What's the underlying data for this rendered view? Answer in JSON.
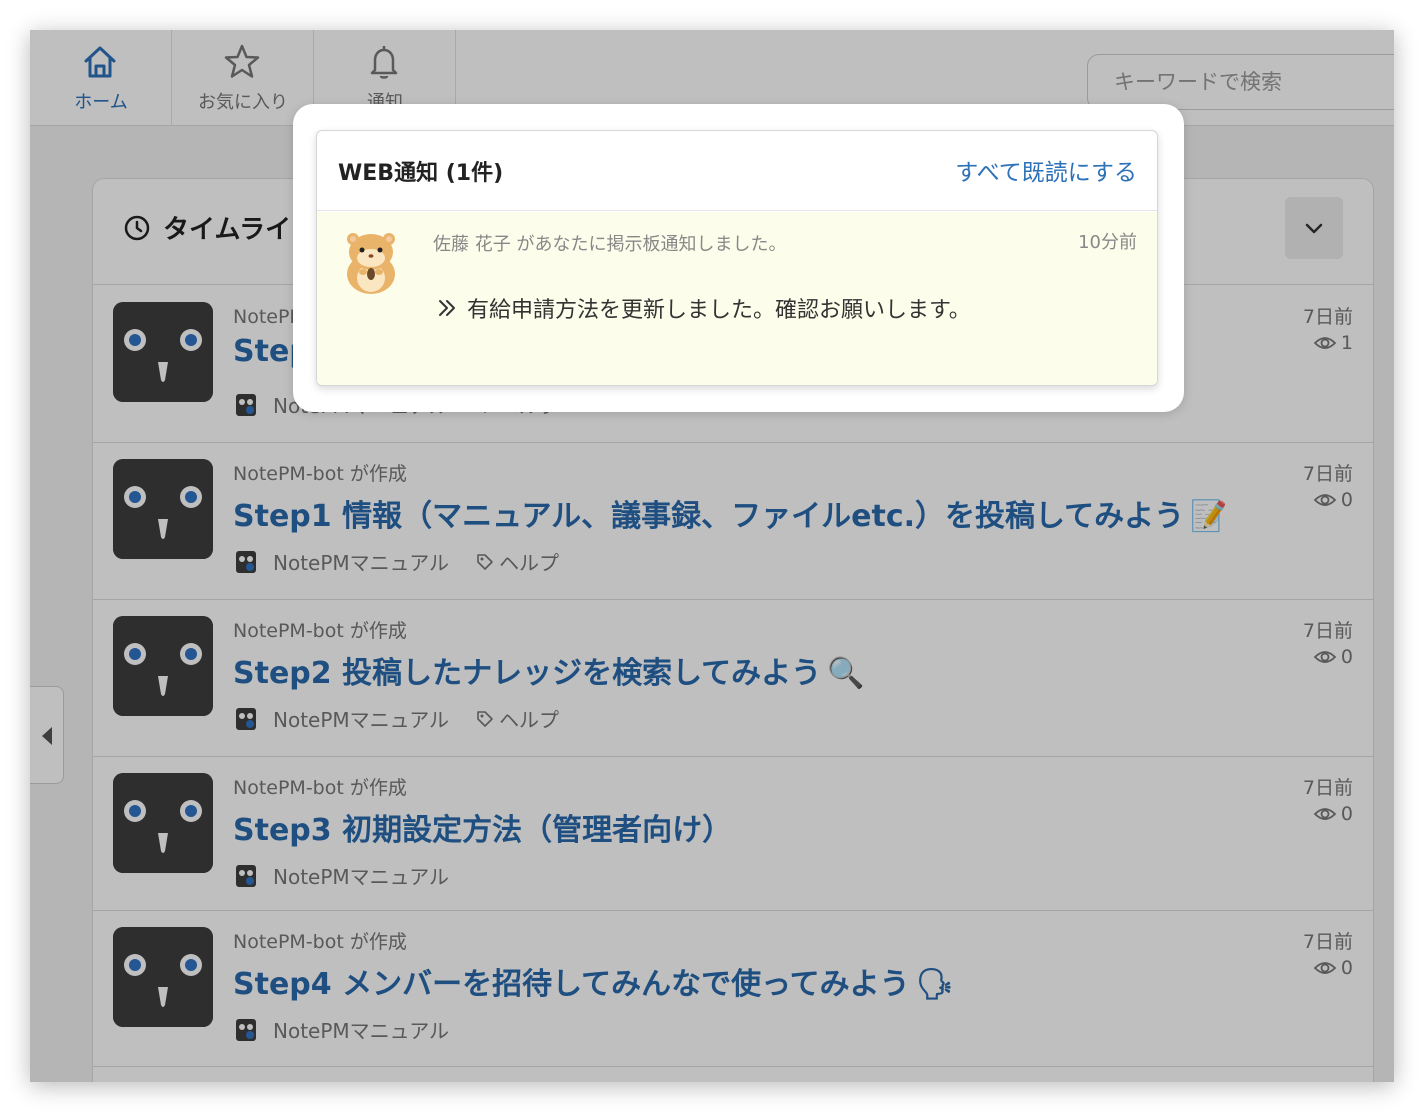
{
  "nav": {
    "tabs": [
      {
        "label": "ホーム",
        "icon": "home-icon"
      },
      {
        "label": "お気に入り",
        "icon": "star-icon"
      },
      {
        "label": "通知",
        "icon": "bell-icon"
      }
    ],
    "search_placeholder": "キーワードで検索"
  },
  "timeline": {
    "title": "タイムライン",
    "rows": [
      {
        "author": "NotePM-bot が作成",
        "title": "Step0",
        "emoji": "",
        "folder": "NotePMマニュアル",
        "tag": "ヘルプ",
        "time": "7日前",
        "views": "1"
      },
      {
        "author": "NotePM-bot が作成",
        "title": "Step1 情報（マニュアル、議事録、ファイルetc.）を投稿してみよう",
        "emoji": "📝",
        "folder": "NotePMマニュアル",
        "tag": "ヘルプ",
        "time": "7日前",
        "views": "0"
      },
      {
        "author": "NotePM-bot が作成",
        "title": "Step2 投稿したナレッジを検索してみよう",
        "emoji": "🔍",
        "folder": "NotePMマニュアル",
        "tag": "ヘルプ",
        "time": "7日前",
        "views": "0"
      },
      {
        "author": "NotePM-bot が作成",
        "title": "Step3 初期設定方法（管理者向け）",
        "emoji": "",
        "folder": "NotePMマニュアル",
        "tag": "",
        "time": "7日前",
        "views": "0"
      },
      {
        "author": "NotePM-bot が作成",
        "title": "Step4 メンバーを招待してみんなで使ってみよう",
        "emoji": "🗣",
        "folder": "NotePMマニュアル",
        "tag": "",
        "time": "7日前",
        "views": "0"
      }
    ]
  },
  "popup": {
    "title": "WEB通知 (1件)",
    "mark_all_read": "すべて既読にする",
    "notification": {
      "sender": "佐藤 花子 があなたに掲示板通知しました。",
      "time": "10分前",
      "message": "有給申請方法を更新しました。確認お願いします。"
    }
  },
  "colors": {
    "accent": "#2d71b8",
    "link_title": "#2a6aac",
    "notif_bg": "#fdfdeb",
    "avatar_bg": "#3e3e3e"
  }
}
